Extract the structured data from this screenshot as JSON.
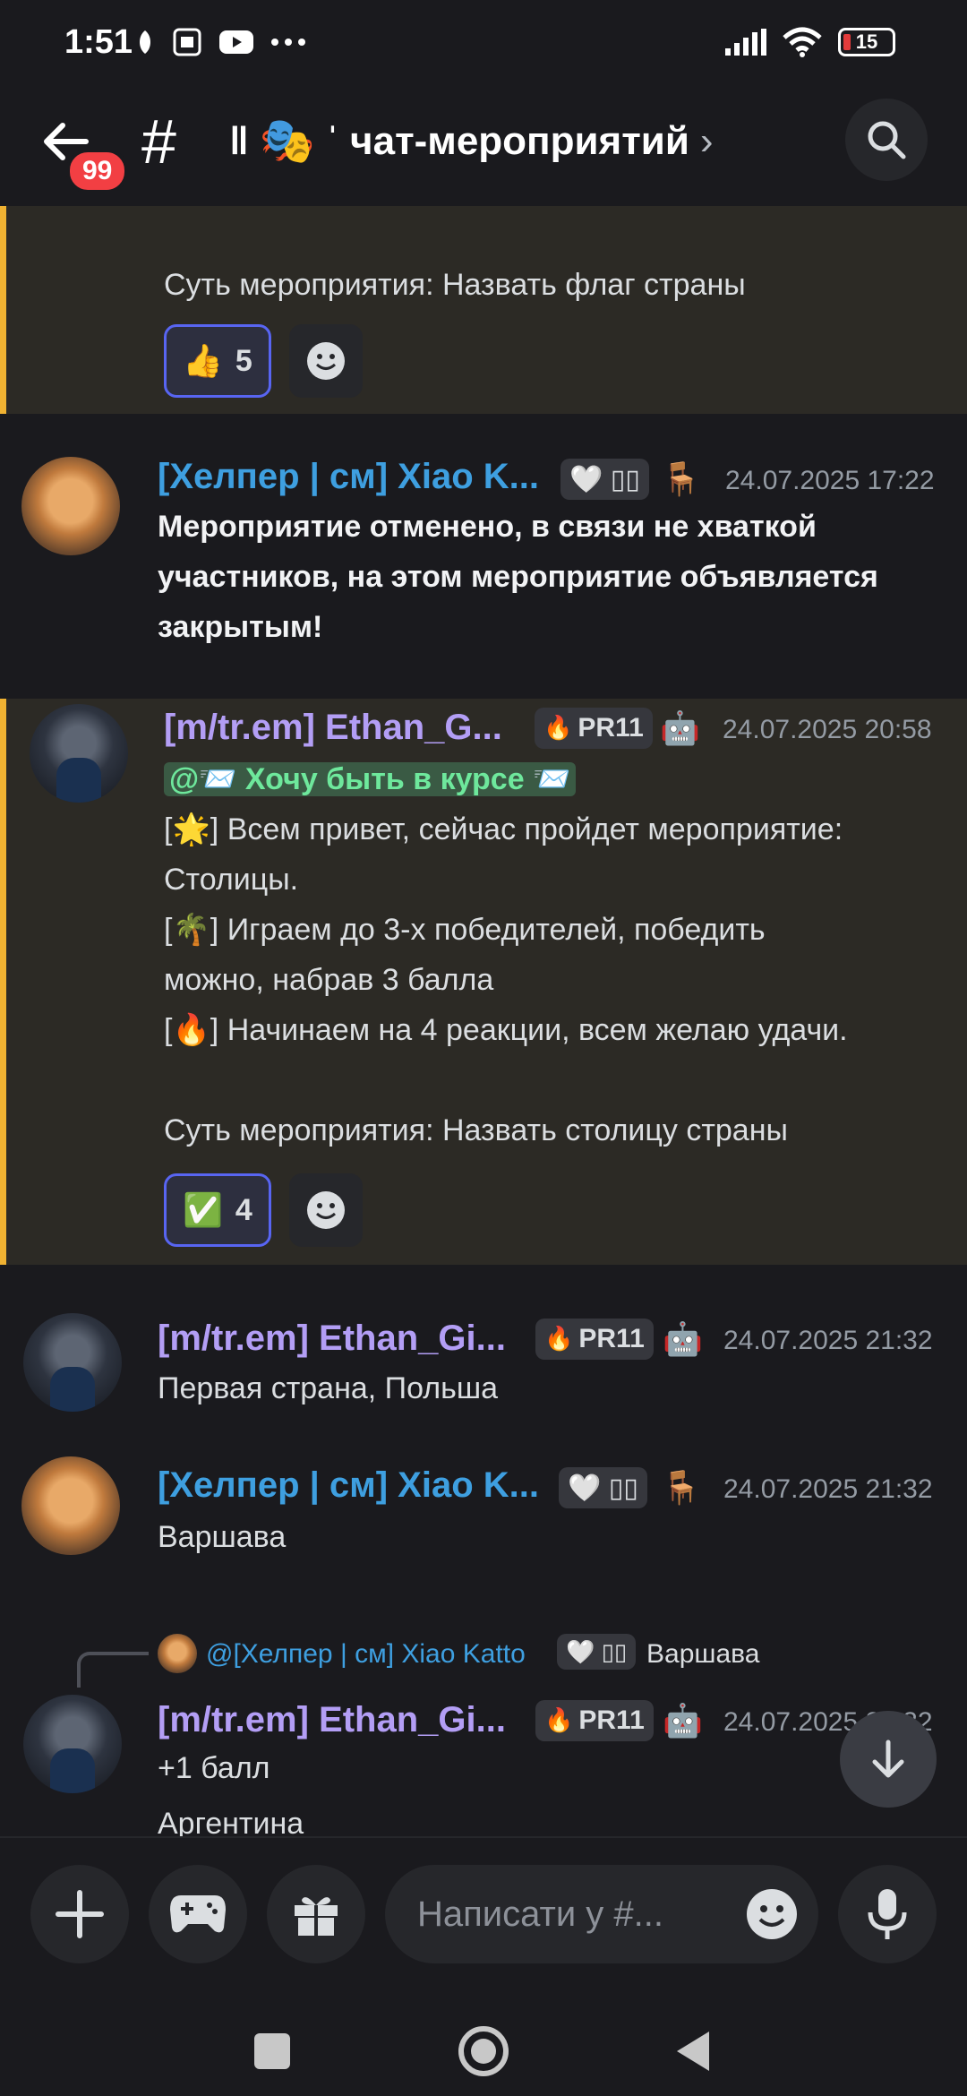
{
  "status": {
    "time": "1:51",
    "battery": "15"
  },
  "header": {
    "badge": "99",
    "hash": "#",
    "channel_prefix": "ǁ",
    "channel_emoji": "🎭",
    "channel_name": "ˈ чат-мероприятий",
    "chevron": "›"
  },
  "messages": [
    {
      "text": "Суть мероприятия: Назвать флаг страны",
      "reaction": {
        "emoji": "👍",
        "count": "5"
      }
    },
    {
      "author": "[Хелпер | см] Xiao K...",
      "tag": "🤍 ▯▯",
      "extra_emoji": "🪑",
      "timestamp": "24.07.2025 17:22",
      "lines": [
        "Мероприятие отменено, в связи не хваткой",
        "участников, на этом мероприятие объявляется",
        "закрытым!"
      ]
    },
    {
      "author": "[m/tr.em] Ethan_G...",
      "tag": "PR11",
      "tag_emoji": "🔥",
      "extra_emoji": "🤖",
      "timestamp": "24.07.2025 20:58",
      "mention": "@📨 Хочу быть в курсе 📨",
      "line1a": "[",
      "line1_emoji": "🌟",
      "line1b": "] Всем привет, сейчас пройдет мероприятие:",
      "line2": "Столицы.",
      "line3_emoji": "🌴",
      "line3b": "] Играем до 3-х победителей, победить",
      "line4": "можно, набрав 3 балла",
      "line5_emoji": "🔥",
      "line5b": "] Начинаем на 4 реакции, всем желаю удачи.",
      "line6": "Суть мероприятия: Назвать столицу страны",
      "reaction": {
        "emoji": "✅",
        "count": "4"
      }
    },
    {
      "author": "[m/tr.em] Ethan_Gi...",
      "tag": "PR11",
      "timestamp": "24.07.2025 21:32",
      "text": "Первая страна, Польша"
    },
    {
      "author": "[Хелпер | см] Xiao K...",
      "tag": "🤍 ▯▯",
      "timestamp": "24.07.2025 21:32",
      "text": "Варшава"
    },
    {
      "reply_name": "@[Хелпер | см] Xiao Katto",
      "reply_tag": "🤍 ▯▯",
      "reply_text": "Варшава",
      "author": "[m/tr.em] Ethan_Gi...",
      "tag": "PR11",
      "timestamp": "24.07.2025 21:32",
      "line1": "+1 балл",
      "line2": "Аргентина"
    }
  ],
  "composer": {
    "placeholder": "Написати у #..."
  }
}
